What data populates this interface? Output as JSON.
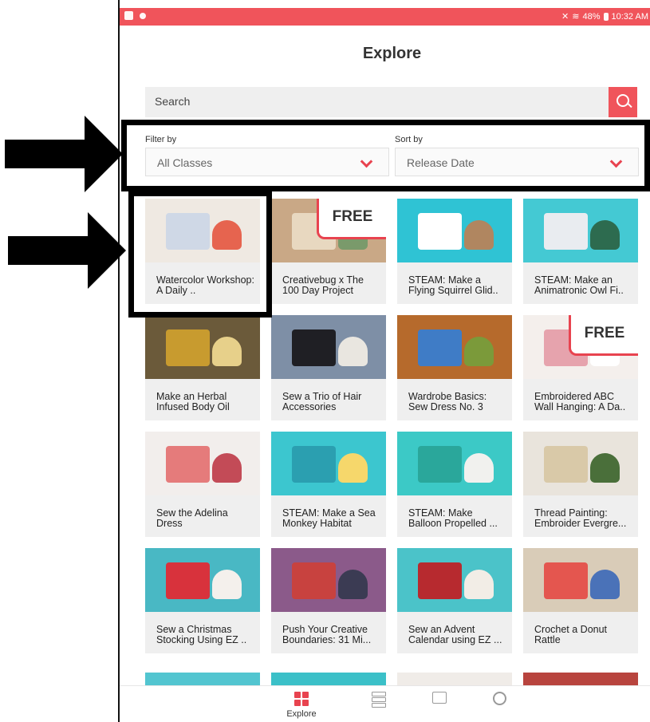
{
  "status_bar": {
    "battery": "48%",
    "time": "10:32 AM"
  },
  "page_title": "Explore",
  "search": {
    "placeholder": "Search"
  },
  "filter": {
    "label": "Filter by",
    "value": "All Classes"
  },
  "sort": {
    "label": "Sort by",
    "value": "Release Date"
  },
  "free_badge": "FREE",
  "classes": [
    {
      "title": "Watercolor Workshop: A Daily ..",
      "free": false,
      "colors": [
        "#efe9e2",
        "#cfd8e6",
        "#e6644f"
      ]
    },
    {
      "title": "Creativebug x The 100 Day Project",
      "free": true,
      "colors": [
        "#c9a886",
        "#e8d8c0",
        "#7a9a6b"
      ]
    },
    {
      "title": "STEAM: Make a Flying Squirrel Glid..",
      "free": false,
      "colors": [
        "#2fc3d4",
        "#ffffff",
        "#b08660"
      ]
    },
    {
      "title": "STEAM: Make an Animatronic Owl Fi..",
      "free": false,
      "colors": [
        "#44c9d3",
        "#e9ecf0",
        "#2d6b4f"
      ]
    },
    {
      "title": "Make an Herbal Infused Body Oil",
      "free": false,
      "colors": [
        "#6b5a3a",
        "#c89b2f",
        "#e7d08a"
      ]
    },
    {
      "title": "Sew a Trio of Hair Accessories",
      "free": false,
      "colors": [
        "#7e8fa6",
        "#1f1f24",
        "#e9e6e0"
      ]
    },
    {
      "title": "Wardrobe Basics: Sew Dress No. 3",
      "free": false,
      "colors": [
        "#b66a2c",
        "#3f7cc6",
        "#7b9a3a"
      ]
    },
    {
      "title": "Embroidered ABC Wall Hanging: A Da..",
      "free": true,
      "colors": [
        "#f4efec",
        "#e6a3ad",
        "#ffffff"
      ]
    },
    {
      "title": "Sew the Adelina Dress",
      "free": false,
      "colors": [
        "#f2eeec",
        "#e57b7b",
        "#c34b57"
      ]
    },
    {
      "title": "STEAM: Make a Sea Monkey Habitat",
      "free": false,
      "colors": [
        "#3cc6cf",
        "#2b9fb0",
        "#f6d76b"
      ]
    },
    {
      "title": "STEAM: Make Balloon Propelled ...",
      "free": false,
      "colors": [
        "#3cc9c6",
        "#2aa79b",
        "#f1f1ee"
      ]
    },
    {
      "title": "Thread Painting: Embroider Evergre...",
      "free": false,
      "colors": [
        "#e9e4dc",
        "#d9c9a8",
        "#4a6f3a"
      ]
    },
    {
      "title": "Sew a Christmas Stocking Using EZ ..",
      "free": false,
      "colors": [
        "#49b8c4",
        "#d8323c",
        "#f4f0ec"
      ]
    },
    {
      "title": "Push Your Creative Boundaries: 31 Mi...",
      "free": false,
      "colors": [
        "#8b5a8a",
        "#c8423f",
        "#3b3b53"
      ]
    },
    {
      "title": "Sew an Advent Calendar using EZ ...",
      "free": false,
      "colors": [
        "#4bc3c9",
        "#b72a2f",
        "#f2ede6"
      ]
    },
    {
      "title": "Crochet a Donut Rattle",
      "free": false,
      "colors": [
        "#d9ccb8",
        "#e4564f",
        "#4a72b8"
      ]
    }
  ],
  "tabs": [
    {
      "label": "Explore",
      "icon": "explore-grid-icon",
      "active": true
    },
    {
      "label": "",
      "icon": "library-stack-icon",
      "active": false
    },
    {
      "label": "",
      "icon": "certificate-icon",
      "active": false
    },
    {
      "label": "",
      "icon": "gear-icon",
      "active": false
    }
  ],
  "colors": {
    "accent": "#e8434f",
    "status_bar": "#f0545b",
    "card_bg": "#efefef"
  }
}
